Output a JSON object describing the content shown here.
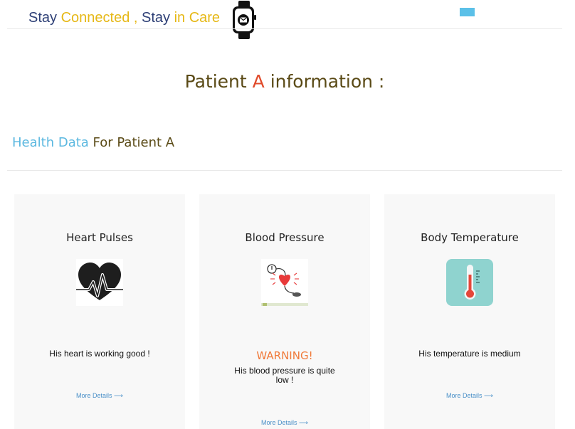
{
  "header": {
    "brand": {
      "part1": "Stay ",
      "part2": "Connected",
      "part3": " , ",
      "part4": "Stay ",
      "part5": "in Care"
    },
    "logo_icon": "smartwatch-mail-icon",
    "menu_icon": "menu-toggle"
  },
  "page_title": {
    "before": "Patient ",
    "accent": "A",
    "after": " information :"
  },
  "section_title": {
    "lead": "Health Data",
    "rest": " For Patient A"
  },
  "cards": [
    {
      "title": "Heart Pulses",
      "icon": "heart-pulse-icon",
      "status": "His heart is working good !",
      "more": "More Details ⟶"
    },
    {
      "title": "Blood Pressure",
      "icon": "blood-pressure-icon",
      "warning": "WARNING!",
      "status": "His blood pressure is quite low !",
      "more": "More Details ⟶"
    },
    {
      "title": "Body Temperature",
      "icon": "thermometer-icon",
      "status": "His temperature is medium",
      "more": "More Details ⟶"
    }
  ],
  "colors": {
    "brand_navy": "#2c3e75",
    "brand_gold": "#e6b817",
    "title_brown": "#5a4a16",
    "accent_red": "#e04a2a",
    "accent_blue": "#5bb8e0",
    "warning_orange": "#f07a3a",
    "link_blue": "#4a90c8"
  }
}
